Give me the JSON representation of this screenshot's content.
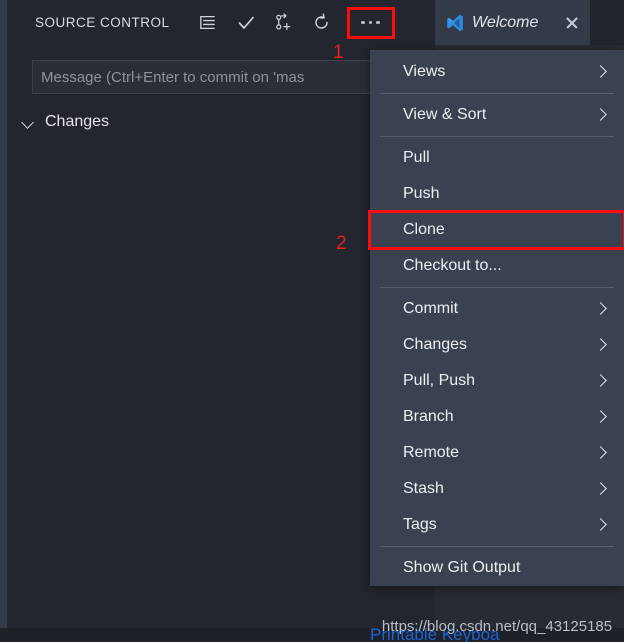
{
  "window": {
    "background_color": "#23262e",
    "menu_background_color": "#3a4150",
    "accent_red": "#fb0d0d",
    "tab_active_color": "#343b48"
  },
  "tabbar": {
    "tabs": [
      {
        "label": "Welcome",
        "icon": "vscode-logo-icon",
        "close_icon": "close-icon",
        "active": true
      }
    ]
  },
  "source_control": {
    "title": "SOURCE CONTROL",
    "actions": [
      {
        "name": "view-as-list-icon",
        "tooltip": "View as Tree"
      },
      {
        "name": "check-icon",
        "tooltip": "Commit"
      },
      {
        "name": "git-branch-create-icon",
        "tooltip": "Create Branch"
      },
      {
        "name": "refresh-icon",
        "tooltip": "Refresh"
      },
      {
        "name": "more-actions-icon",
        "tooltip": "More Actions...",
        "highlighted": true
      }
    ],
    "commit_input": {
      "placeholder": "Message (Ctrl+Enter to commit on 'mas",
      "value": ""
    },
    "groups": [
      {
        "label": "Changes",
        "expanded": true,
        "chevron": "chevron-down-icon"
      }
    ]
  },
  "context_menu": {
    "items": [
      {
        "label": "Views",
        "submenu": true
      },
      {
        "separator": true
      },
      {
        "label": "View & Sort",
        "submenu": true
      },
      {
        "separator": true
      },
      {
        "label": "Pull",
        "submenu": false
      },
      {
        "label": "Push",
        "submenu": false
      },
      {
        "label": "Clone",
        "submenu": false,
        "highlighted": true
      },
      {
        "label": "Checkout to...",
        "submenu": false
      },
      {
        "separator": true
      },
      {
        "label": "Commit",
        "submenu": true
      },
      {
        "label": "Changes",
        "submenu": true
      },
      {
        "label": "Pull, Push",
        "submenu": true
      },
      {
        "label": "Branch",
        "submenu": true
      },
      {
        "label": "Remote",
        "submenu": true
      },
      {
        "label": "Stash",
        "submenu": true
      },
      {
        "label": "Tags",
        "submenu": true
      },
      {
        "separator": true
      },
      {
        "label": "Show Git Output",
        "submenu": false
      }
    ]
  },
  "annotations": [
    {
      "label": "1",
      "target": "more-actions-icon"
    },
    {
      "label": "2",
      "target": "clone-menu-item"
    }
  ],
  "watermark": {
    "url": "https://blog.csdn.net/qq_43125185",
    "bottom_text": "Printable Keyboa"
  }
}
